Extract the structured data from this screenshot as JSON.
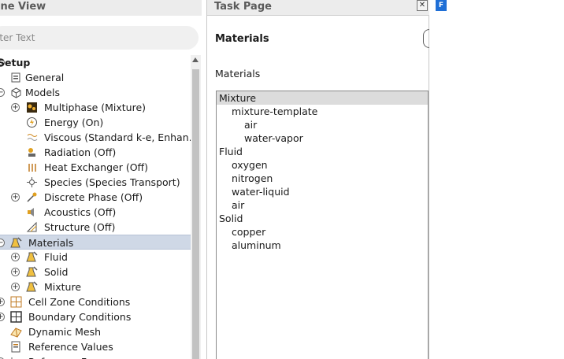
{
  "outline": {
    "title": "ine View",
    "filter_placeholder": "lter Text",
    "items": [
      {
        "label": "Setup",
        "bold": true,
        "expander": "-",
        "icon": ""
      },
      {
        "label": "General",
        "icon": "general-icon"
      },
      {
        "label": "Models",
        "expander": "-",
        "icon": "models-icon"
      },
      {
        "label": "Multiphase (Mixture)",
        "expander": "+",
        "icon": "multiphase-icon"
      },
      {
        "label": "Energy (On)",
        "icon": "energy-icon"
      },
      {
        "label": "Viscous (Standard k-e, Enhan…",
        "icon": "viscous-icon"
      },
      {
        "label": "Radiation (Off)",
        "icon": "radiation-icon"
      },
      {
        "label": "Heat Exchanger (Off)",
        "icon": "heat-exchanger-icon"
      },
      {
        "label": "Species (Species Transport)",
        "icon": "species-icon"
      },
      {
        "label": "Discrete Phase (Off)",
        "expander": "+",
        "icon": "discrete-phase-icon"
      },
      {
        "label": "Acoustics (Off)",
        "icon": "acoustics-icon"
      },
      {
        "label": "Structure (Off)",
        "icon": "structure-icon"
      },
      {
        "label": "Materials",
        "expander": "-",
        "icon": "materials-icon",
        "selected": true
      },
      {
        "label": "Fluid",
        "expander": "+",
        "icon": "fluid-material-icon"
      },
      {
        "label": "Solid",
        "expander": "+",
        "icon": "solid-material-icon"
      },
      {
        "label": "Mixture",
        "expander": "+",
        "icon": "mixture-material-icon"
      },
      {
        "label": "Cell Zone Conditions",
        "expander": "+",
        "icon": "cell-zone-icon"
      },
      {
        "label": "Boundary Conditions",
        "expander": "+",
        "icon": "boundary-conditions-icon"
      },
      {
        "label": "Dynamic Mesh",
        "icon": "dynamic-mesh-icon"
      },
      {
        "label": "Reference Values",
        "icon": "reference-values-icon"
      },
      {
        "label": "Reference F",
        "expander": "+",
        "icon": "reference-frames-icon"
      }
    ]
  },
  "task": {
    "title": "Task Page",
    "close_glyph": "✕",
    "heading": "Materials",
    "list_label": "Materials",
    "list": [
      {
        "text": "Mixture",
        "level": 0,
        "selected": true
      },
      {
        "text": "mixture-template",
        "level": 1
      },
      {
        "text": "air",
        "level": 2
      },
      {
        "text": "water-vapor",
        "level": 2
      },
      {
        "text": "Fluid",
        "level": 0
      },
      {
        "text": "oxygen",
        "level": 1
      },
      {
        "text": "nitrogen",
        "level": 1
      },
      {
        "text": "water-liquid",
        "level": 1
      },
      {
        "text": "air",
        "level": 1
      },
      {
        "text": "Solid",
        "level": 0
      },
      {
        "text": "copper",
        "level": 1
      },
      {
        "text": "aluminum",
        "level": 1
      }
    ]
  },
  "graphics": {
    "icon_letter": "F",
    "accent": "#1f6fd6"
  }
}
